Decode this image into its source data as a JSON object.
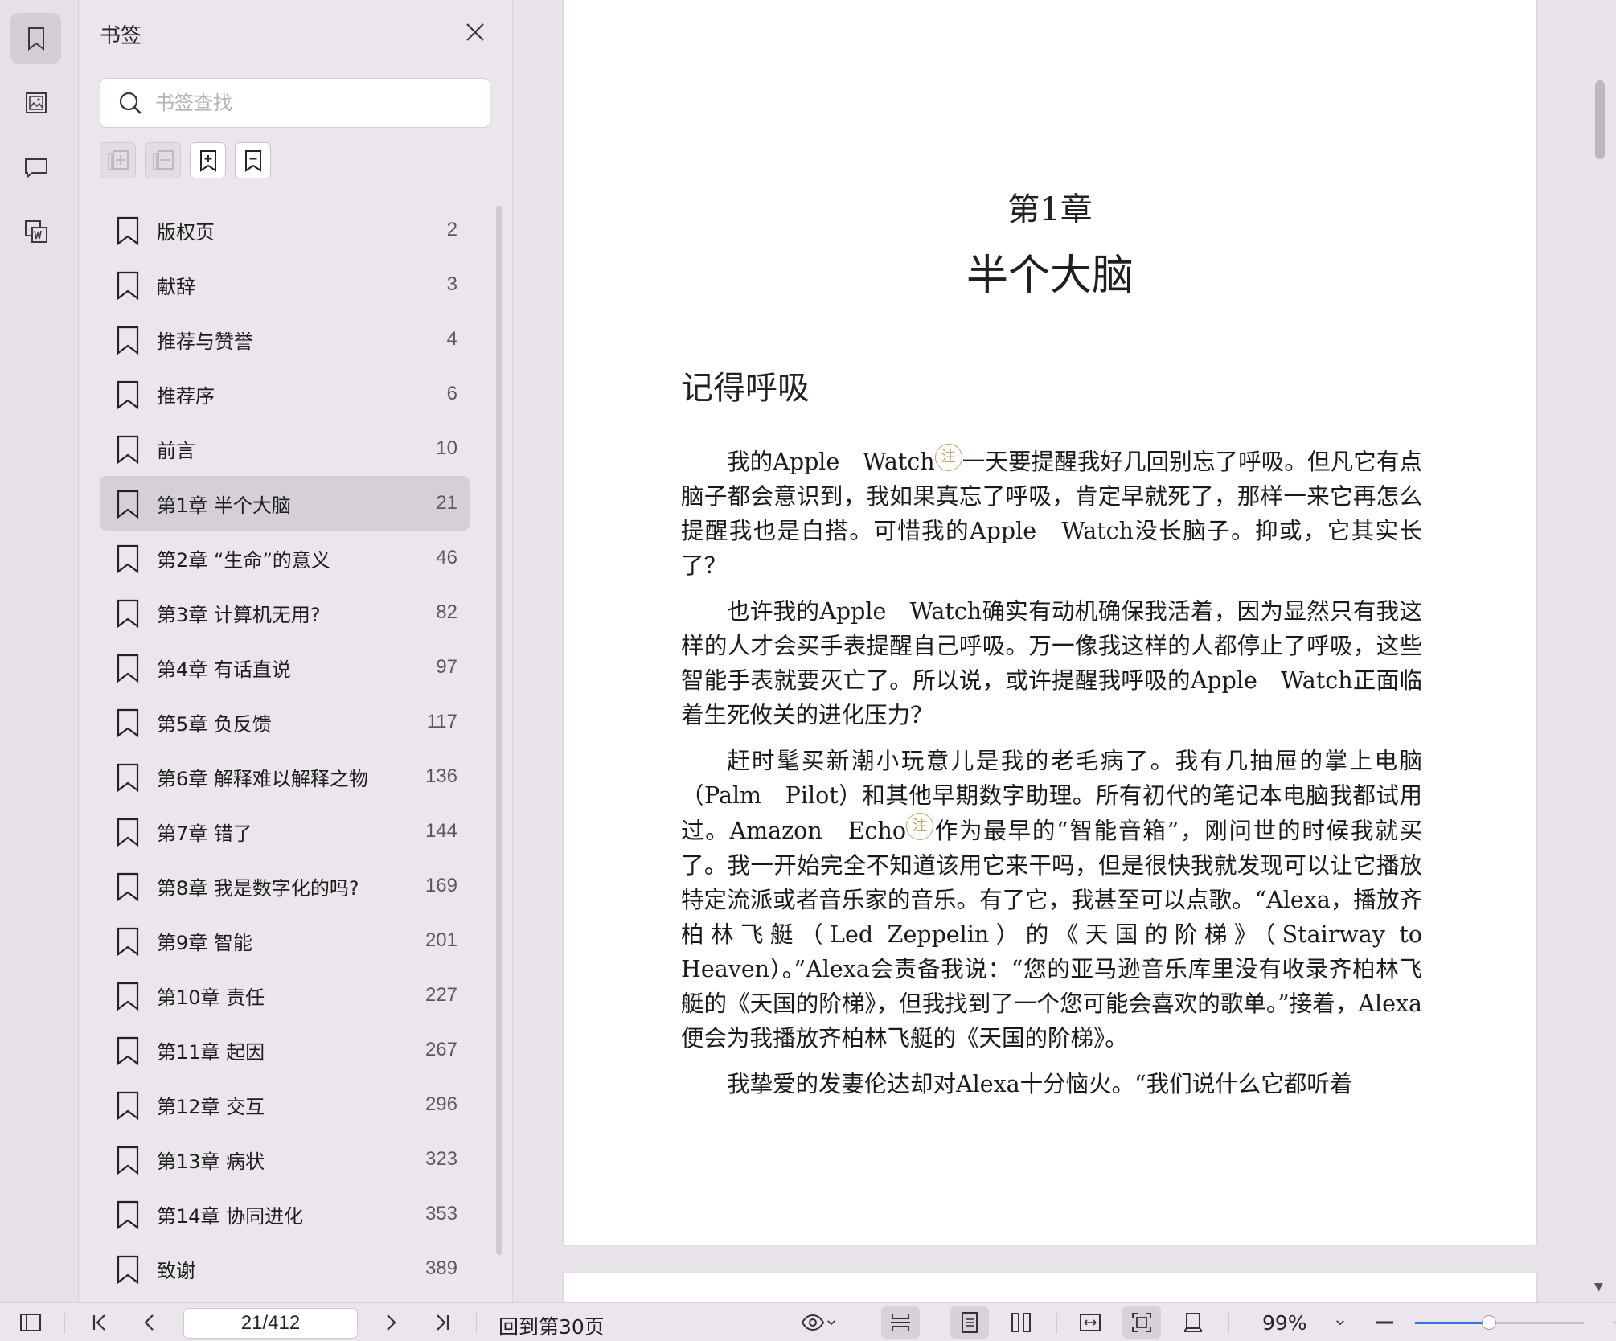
{
  "sidebar_rail": {
    "items": [
      {
        "name": "bookmark",
        "icon": "bookmark-icon",
        "active": true
      },
      {
        "name": "thumbnails",
        "icon": "image-icon",
        "active": false
      },
      {
        "name": "comments",
        "icon": "comment-icon",
        "active": false
      },
      {
        "name": "word",
        "icon": "word-convert-icon",
        "active": false
      }
    ]
  },
  "bookmark_panel": {
    "title": "书签",
    "search_placeholder": "书签查找",
    "tools": [
      "expand-all-icon",
      "collapse-all-icon",
      "add-bookmark-icon",
      "remove-bookmark-icon"
    ],
    "items": [
      {
        "label": "版权页",
        "page": "2"
      },
      {
        "label": "献辞",
        "page": "3"
      },
      {
        "label": "推荐与赞誉",
        "page": "4"
      },
      {
        "label": "推荐序",
        "page": "6"
      },
      {
        "label": "前言",
        "page": "10"
      },
      {
        "label": "第1章 半个大脑",
        "page": "21",
        "selected": true
      },
      {
        "label": "第2章 “生命”的意义",
        "page": "46"
      },
      {
        "label": "第3章 计算机无用?",
        "page": "82"
      },
      {
        "label": "第4章 有话直说",
        "page": "97"
      },
      {
        "label": "第5章 负反馈",
        "page": "117"
      },
      {
        "label": "第6章 解释难以解释之物",
        "page": "136"
      },
      {
        "label": "第7章 错了",
        "page": "144"
      },
      {
        "label": "第8章 我是数字化的吗?",
        "page": "169"
      },
      {
        "label": "第9章 智能",
        "page": "201"
      },
      {
        "label": "第10章 责任",
        "page": "227"
      },
      {
        "label": "第11章 起因",
        "page": "267"
      },
      {
        "label": "第12章 交互",
        "page": "296"
      },
      {
        "label": "第13章 病状",
        "page": "323"
      },
      {
        "label": "第14章 协同进化",
        "page": "353"
      },
      {
        "label": "致谢",
        "page": "389"
      }
    ]
  },
  "document": {
    "chapter_no": "第1章",
    "chapter_title": "半个大脑",
    "section_title": "记得呼吸",
    "note_mark": "注",
    "p1_a": "我的Apple　Watch",
    "p1_b": "一天要提醒我好几回别忘了呼吸。但凡它有点脑子都会意识到，我如果真忘了呼吸，肯定早就死了，那样一来它再怎么提醒我也是白搭。可惜我的Apple　Watch没长脑子。抑或，它其实长了？",
    "p2": "也许我的Apple　Watch确实有动机确保我活着，因为显然只有我这样的人才会买手表提醒自己呼吸。万一像我这样的人都停止了呼吸，这些智能手表就要灭亡了。所以说，或许提醒我呼吸的Apple　Watch正面临着生死攸关的进化压力？",
    "p3_a": "赶时髦买新潮小玩意儿是我的老毛病了。我有几抽屉的掌上电脑（Palm　Pilot）和其他早期数字助理。所有初代的笔记本电脑我都试用过。Amazon　Echo",
    "p3_b": "作为最早的“智能音箱”，刚问世的时候我就买了。我一开始完全不知道该用它来干吗，但是很快我就发现可以让它播放特定流派或者音乐家的音乐。有了它，我甚至可以点歌。“Alexa，播放齐柏林飞艇（Led Zeppelin）的《天国的阶梯》（Stairway to Heaven）。”Alexa会责备我说：“您的亚马逊音乐库里没有收录齐柏林飞艇的《天国的阶梯》，但我找到了一个您可能会喜欢的歌单。”接着，Alexa便会为我播放齐柏林飞艇的《天国的阶梯》。",
    "p4": "我挚爱的发妻伦达却对Alexa十分恼火。“我们说什么它都听着"
  },
  "bottom_bar": {
    "page_value": "21/412",
    "go_back_label": "回到第30页",
    "zoom_label": "99%",
    "zoom_fraction": 0.44
  }
}
